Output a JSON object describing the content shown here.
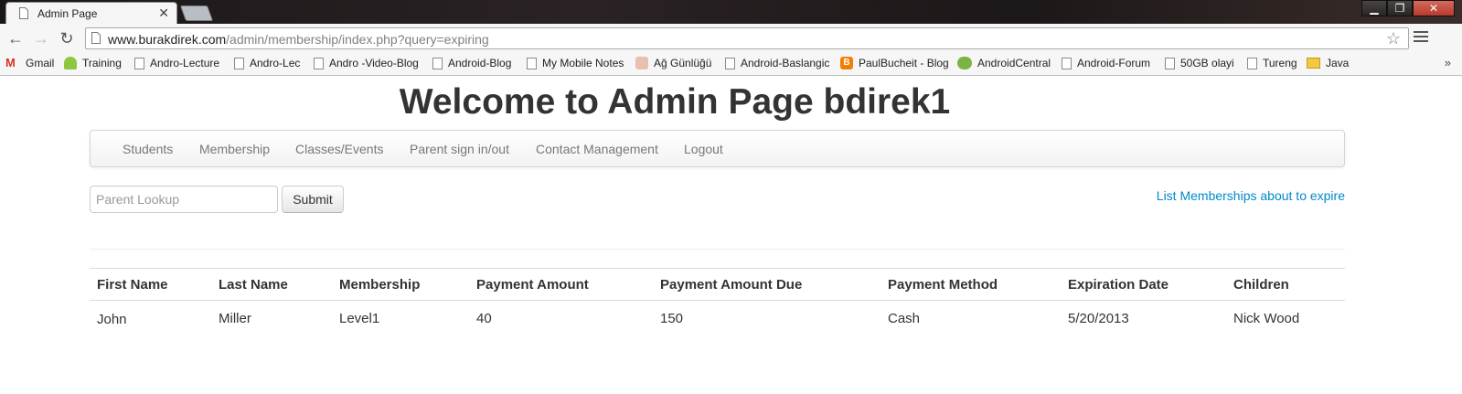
{
  "browser": {
    "tab_title": "Admin Page",
    "tab_close": "✕",
    "url_host": "www.burakdirek.com",
    "url_path": "/admin/membership/index.php?query=expiring",
    "bookmarks": [
      {
        "label": "Gmail",
        "icon": "gmail-icon"
      },
      {
        "label": "Training",
        "icon": "android-icon"
      },
      {
        "label": "Andro-Lecture",
        "icon": "page-icon"
      },
      {
        "label": "Andro-Lec",
        "icon": "page-icon"
      },
      {
        "label": "Andro -Video-Blog",
        "icon": "page-icon"
      },
      {
        "label": "Android-Blog",
        "icon": "page-icon"
      },
      {
        "label": "My Mobile Notes",
        "icon": "page-icon"
      },
      {
        "label": "Ağ Günlüğü",
        "icon": "blog-icon"
      },
      {
        "label": "Android-Baslangic",
        "icon": "page-icon"
      },
      {
        "label": "PaulBucheit - Blog",
        "icon": "blogger-icon"
      },
      {
        "label": "AndroidCentral",
        "icon": "androidcentral-icon"
      },
      {
        "label": "Android-Forum",
        "icon": "page-icon"
      },
      {
        "label": "50GB olayi",
        "icon": "page-icon"
      },
      {
        "label": "Tureng",
        "icon": "page-icon"
      },
      {
        "label": "Java",
        "icon": "folder-icon"
      }
    ],
    "more": "»"
  },
  "page": {
    "title": "Welcome to Admin Page bdirek1",
    "nav": [
      "Students",
      "Membership",
      "Classes/Events",
      "Parent sign in/out",
      "Contact Management",
      "Logout"
    ],
    "lookup_placeholder": "Parent Lookup",
    "submit_label": "Submit",
    "expire_link": "List Memberships about to expire"
  },
  "table": {
    "headers": [
      "First Name",
      "Last Name",
      "Membership",
      "Payment Amount",
      "Payment Amount Due",
      "Payment Method",
      "Expiration Date",
      "Children"
    ],
    "rows": [
      [
        "John",
        "Miller",
        "Level1",
        "40",
        "150",
        "Cash",
        "5/20/2013",
        "Nick Wood"
      ]
    ]
  },
  "colors": {
    "link": "#0088cc",
    "title_text": "#333333",
    "nav_text": "#777777"
  }
}
